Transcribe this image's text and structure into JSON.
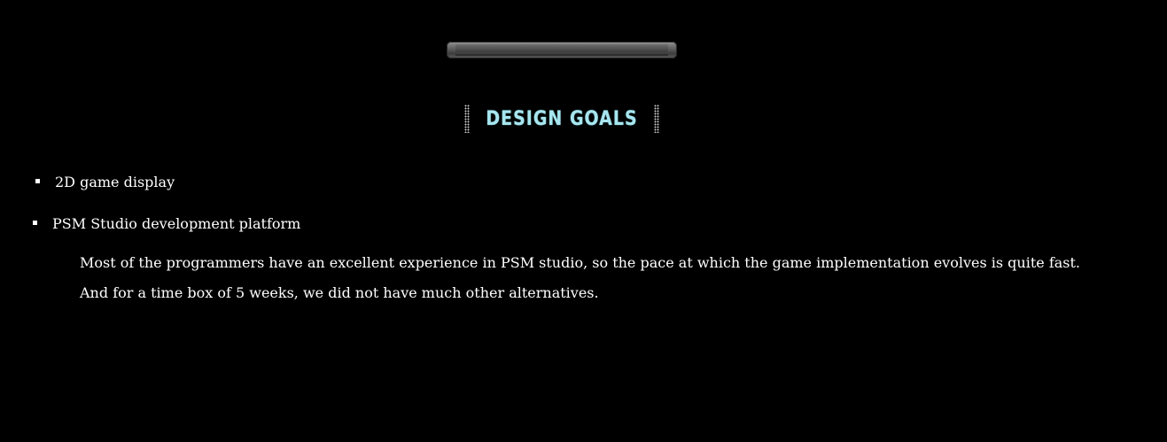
{
  "heading": {
    "title": "DESIGN GOALS"
  },
  "goals": {
    "items": [
      {
        "label": "2D game display"
      },
      {
        "label": "PSM Studio development platform",
        "description": "Most of the programmers have an excellent experience in PSM studio, so the pace at which the game implementation evolves is quite fast. And for a time box of 5 weeks, we did not have much other alternatives."
      }
    ]
  },
  "colors": {
    "background": "#000000",
    "heading": "#a8e6ef",
    "text": "#ffffff"
  },
  "icons": {
    "bullet": "square-bullet-icon",
    "divider": "metal-bar-divider",
    "heading_ornament": "dotted-ornament-icon"
  }
}
